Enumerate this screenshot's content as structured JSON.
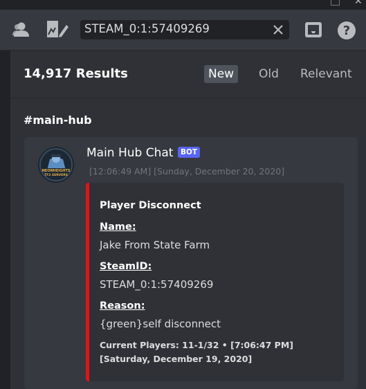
{
  "toolbar": {
    "search_value": "STEAM_0:1:57409269"
  },
  "results": {
    "count": "14,917 Results",
    "sort_options": [
      "New",
      "Old",
      "Relevant"
    ],
    "active_sort": "New"
  },
  "channel": "#main-hub",
  "message": {
    "author": "Main Hub Chat",
    "bot_tag": "BOT",
    "timestamp": "[12:06:49 AM] [Sunday, December 20, 2020]",
    "avatar_text": "NEONHEIGHTS TF2 SERVERS",
    "embed": {
      "title": "Player Disconnect",
      "color": "#e3121a",
      "fields": [
        {
          "name": "Name:",
          "value": "Jake From State Farm"
        },
        {
          "name": "SteamID:",
          "value": "STEAM_0:1:57409269"
        },
        {
          "name": "Reason:",
          "value": "{green}self disconnect"
        }
      ],
      "footer": "Current Players: 11-1/32 • [7:06:47 PM] [Saturday, December 19, 2020]"
    }
  },
  "colors": {
    "accent": "#5865f2",
    "embed_bar": "#e3121a",
    "background": "#36393f"
  }
}
